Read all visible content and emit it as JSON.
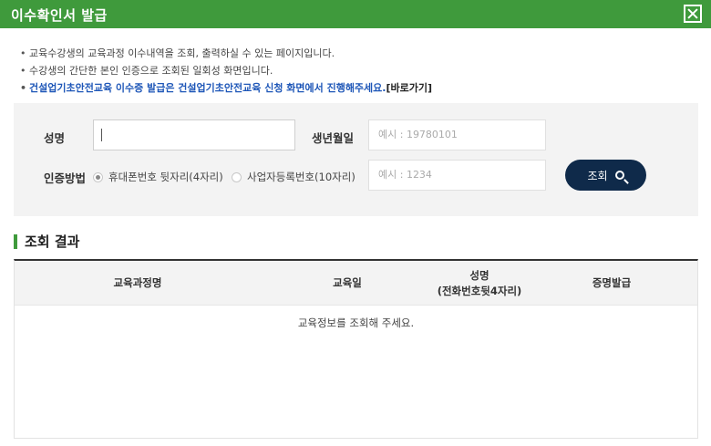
{
  "window": {
    "title": "이수확인서 발급",
    "close_icon": "close-icon"
  },
  "notes": [
    "교육수강생의 교육과정 이수내역을 조회, 출력하실 수 있는 페이지입니다.",
    "수강생의 간단한 본인 인증으로 조회된 일회성 화면입니다."
  ],
  "notice": {
    "text": "건설업기초안전교육 이수증 발급은 건설업기초안전교육 신청 화면에서 진행해주세요.",
    "link": "[바로가기]"
  },
  "form": {
    "name_label": "성명",
    "name_value": "",
    "birth_label": "생년월일",
    "birth_placeholder": "예시 : 19780101",
    "auth_label": "인증방법",
    "auth_options": [
      "휴대폰번호 뒷자리(4자리)",
      "사업자등록번호(10자리)"
    ],
    "auth_selected": "휴대폰번호 뒷자리(4자리)",
    "auth_placeholder": "예시 : 1234",
    "search_label": "조회"
  },
  "result": {
    "title": "조회 결과",
    "columns": [
      "교육과정명",
      "교육일",
      "성명",
      "(전화번호뒷4자리)",
      "증명발급"
    ],
    "empty_message": "교육정보를 조회해 주세요."
  },
  "colors": {
    "accent": "#3f9a3c",
    "button": "#0f2a4a",
    "notice": "#1f57b8"
  }
}
